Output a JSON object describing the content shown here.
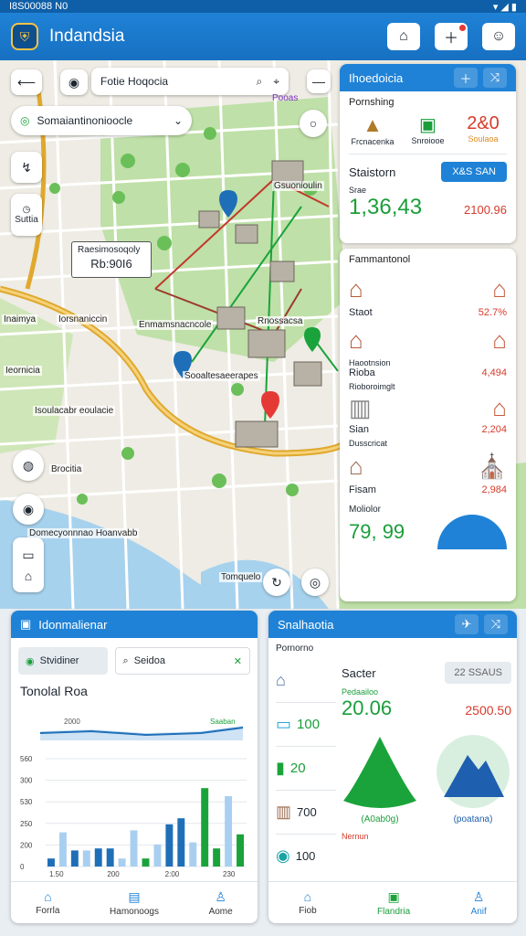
{
  "status_bar": {
    "time": "I8S00088 N0"
  },
  "app_bar": {
    "title": "Indandsia"
  },
  "map": {
    "search_text": "Fotie Hoqocia",
    "dropdown_text": "Somaiantinonioocle",
    "callout": {
      "title": "Raesimosoqoly",
      "value": "Rb:90I6"
    },
    "labels": {
      "tr": "Pooas",
      "pin_label": "Gsuonioulin",
      "left1": "Inaimya",
      "left2": "Iorsnaniccin",
      "mid1": "Enmamsnacncole",
      "mid2": "Rnossacsa",
      "center": "Sooaltesaeerapes",
      "left3": "Ieornicia",
      "road": "Isoulacabr eoulacie",
      "edge": "Brocitia",
      "bottom": "Domecyonnnao Hoanvabb",
      "bottom_right": "Tomquelo",
      "side_caption": "Suttia"
    }
  },
  "top_right_panel": {
    "title": "Ihoedoicia",
    "section_label": "Pornshing",
    "icon_labels": [
      "Frcnacenka",
      "Snroiooe",
      "Soulaoa"
    ],
    "badge_value": "2&0",
    "stat_label": "Staistorn",
    "button_label": "X&S SAN",
    "sub_label": "Srae",
    "big_value": "1,36,43",
    "side_value": "2100.96"
  },
  "mid_right_panel": {
    "header_label": "Fammantonol",
    "rows": [
      {
        "label": "Staot",
        "value": "52.7%"
      },
      {
        "label": "Rioba",
        "value": "4,494"
      },
      {
        "label": "Sian",
        "value": "2,204"
      },
      {
        "label": "Fisam",
        "value": "2,984"
      }
    ],
    "row_headers": [
      "Haootnsion",
      "Rioboroimglt",
      "Dusscricat"
    ],
    "footer_label": "Moliolor",
    "footer_value": "79, 99"
  },
  "bottom_left_panel": {
    "title": "Idonmalienar",
    "tab_active": "Stvidiner",
    "tab_search": "Seidoa",
    "chart_title": "Tonolal Roa",
    "legend_tags": [
      "2000",
      "Saaban"
    ],
    "y_ticks": [
      "560",
      "300",
      "530",
      "250",
      "200",
      "0"
    ],
    "x_ticks": [
      "1.50",
      "200",
      "2:00",
      "230"
    ],
    "nav": [
      "Forrla",
      "Hamonoogs",
      "Aome"
    ]
  },
  "chart_data": {
    "type": "bar",
    "title": "Tonolal Roa",
    "xlabel": "",
    "ylabel": "",
    "y_tick_labels": [
      "560",
      "300",
      "530",
      "250",
      "200",
      "0"
    ],
    "x_tick_labels": [
      "1.50",
      "200",
      "2:00",
      "230"
    ],
    "ylim": [
      0,
      6
    ],
    "bar_heights": [
      0.4,
      1.7,
      0.8,
      0.8,
      0.9,
      0.9,
      0.4,
      1.8,
      0.4,
      1.1,
      2.1,
      2.4,
      1.2,
      3.9,
      0.9,
      3.5,
      1.6
    ],
    "bar_colors": [
      "#1f6fb8",
      "#a9cff0",
      "#1f6fb8",
      "#a9cff0",
      "#1f6fb8",
      "#1f6fb8",
      "#a9cff0",
      "#a9cff0",
      "#1aa33a",
      "#a9cff0",
      "#1f6fb8",
      "#1f6fb8",
      "#a9cff0",
      "#1aa33a",
      "#1aa33a",
      "#a9cff0",
      "#1aa33a"
    ]
  },
  "bottom_right_panel": {
    "title": "Snalhaotia",
    "sub_title": "Pornorno",
    "values_left": [
      "100",
      "20",
      "700",
      "100"
    ],
    "card_label": "Sacter",
    "card_badge": "22 SSAUS",
    "sub_label": "Pedaailoo",
    "big_value": "20.06",
    "side_value": "2500.50",
    "shape_labels": [
      "(A0ab0g)",
      "(poatana)"
    ],
    "footer_label": "Nernun",
    "nav": [
      "Fiob",
      "Flandria",
      "Anif"
    ]
  },
  "colors": {
    "primary": "#1f82d6",
    "green": "#1a9e3a",
    "red": "#d63b2b"
  }
}
